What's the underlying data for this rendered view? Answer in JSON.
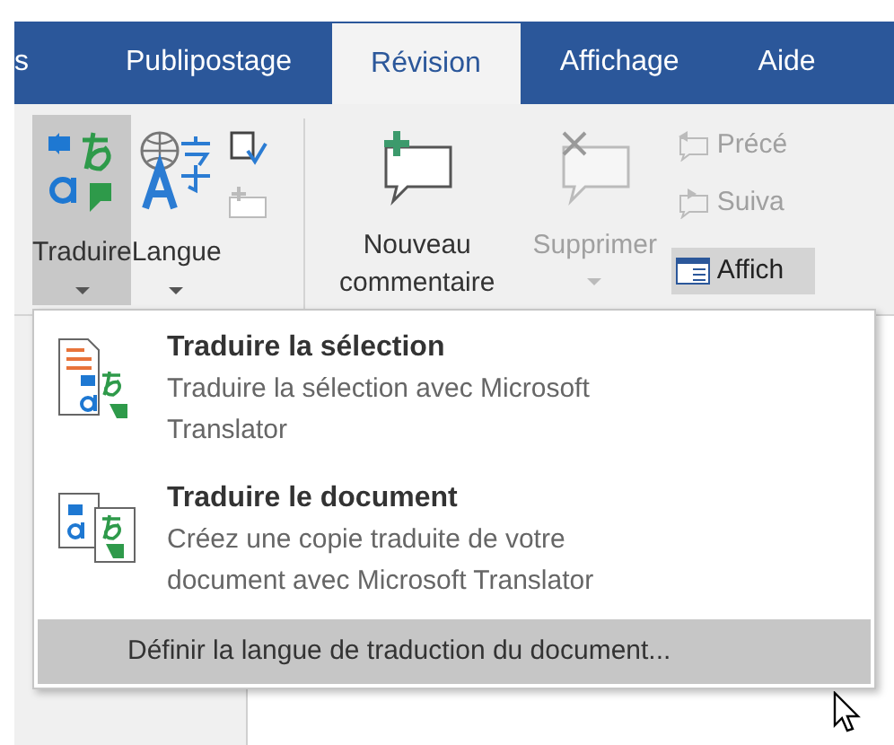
{
  "tabs": [
    {
      "label": "s",
      "selected": false
    },
    {
      "label": "Publipostage",
      "selected": false
    },
    {
      "label": "Révision",
      "selected": true
    },
    {
      "label": "Affichage",
      "selected": false
    },
    {
      "label": "Aide",
      "selected": false
    }
  ],
  "ribbon": {
    "large_buttons": [
      {
        "kind": "translate",
        "label": "Traduire",
        "pressed": true,
        "disabled": false
      },
      {
        "kind": "language",
        "label": "Langue",
        "pressed": false,
        "disabled": false
      }
    ],
    "comment_buttons": [
      {
        "kind": "new_comment",
        "label": "Nouveau commentaire",
        "disabled": false
      },
      {
        "kind": "delete_comment",
        "label": "Supprimer",
        "disabled": true
      }
    ],
    "nav_buttons": [
      {
        "kind": "previous",
        "label": "Précé",
        "disabled": true
      },
      {
        "kind": "next",
        "label": "Suiva",
        "disabled": true
      },
      {
        "kind": "show",
        "label": "Affich",
        "disabled": false
      }
    ]
  },
  "menu": {
    "items": [
      {
        "kind": "selection",
        "title": "Traduire la sélection",
        "description": "Traduire la sélection avec Microsoft Translator"
      },
      {
        "kind": "document",
        "title": "Traduire le document",
        "description": "Créez une copie traduite de votre document avec Microsoft Translator"
      }
    ],
    "footer": {
      "label": "Définir la langue de traduction du document...",
      "selected": true
    }
  }
}
